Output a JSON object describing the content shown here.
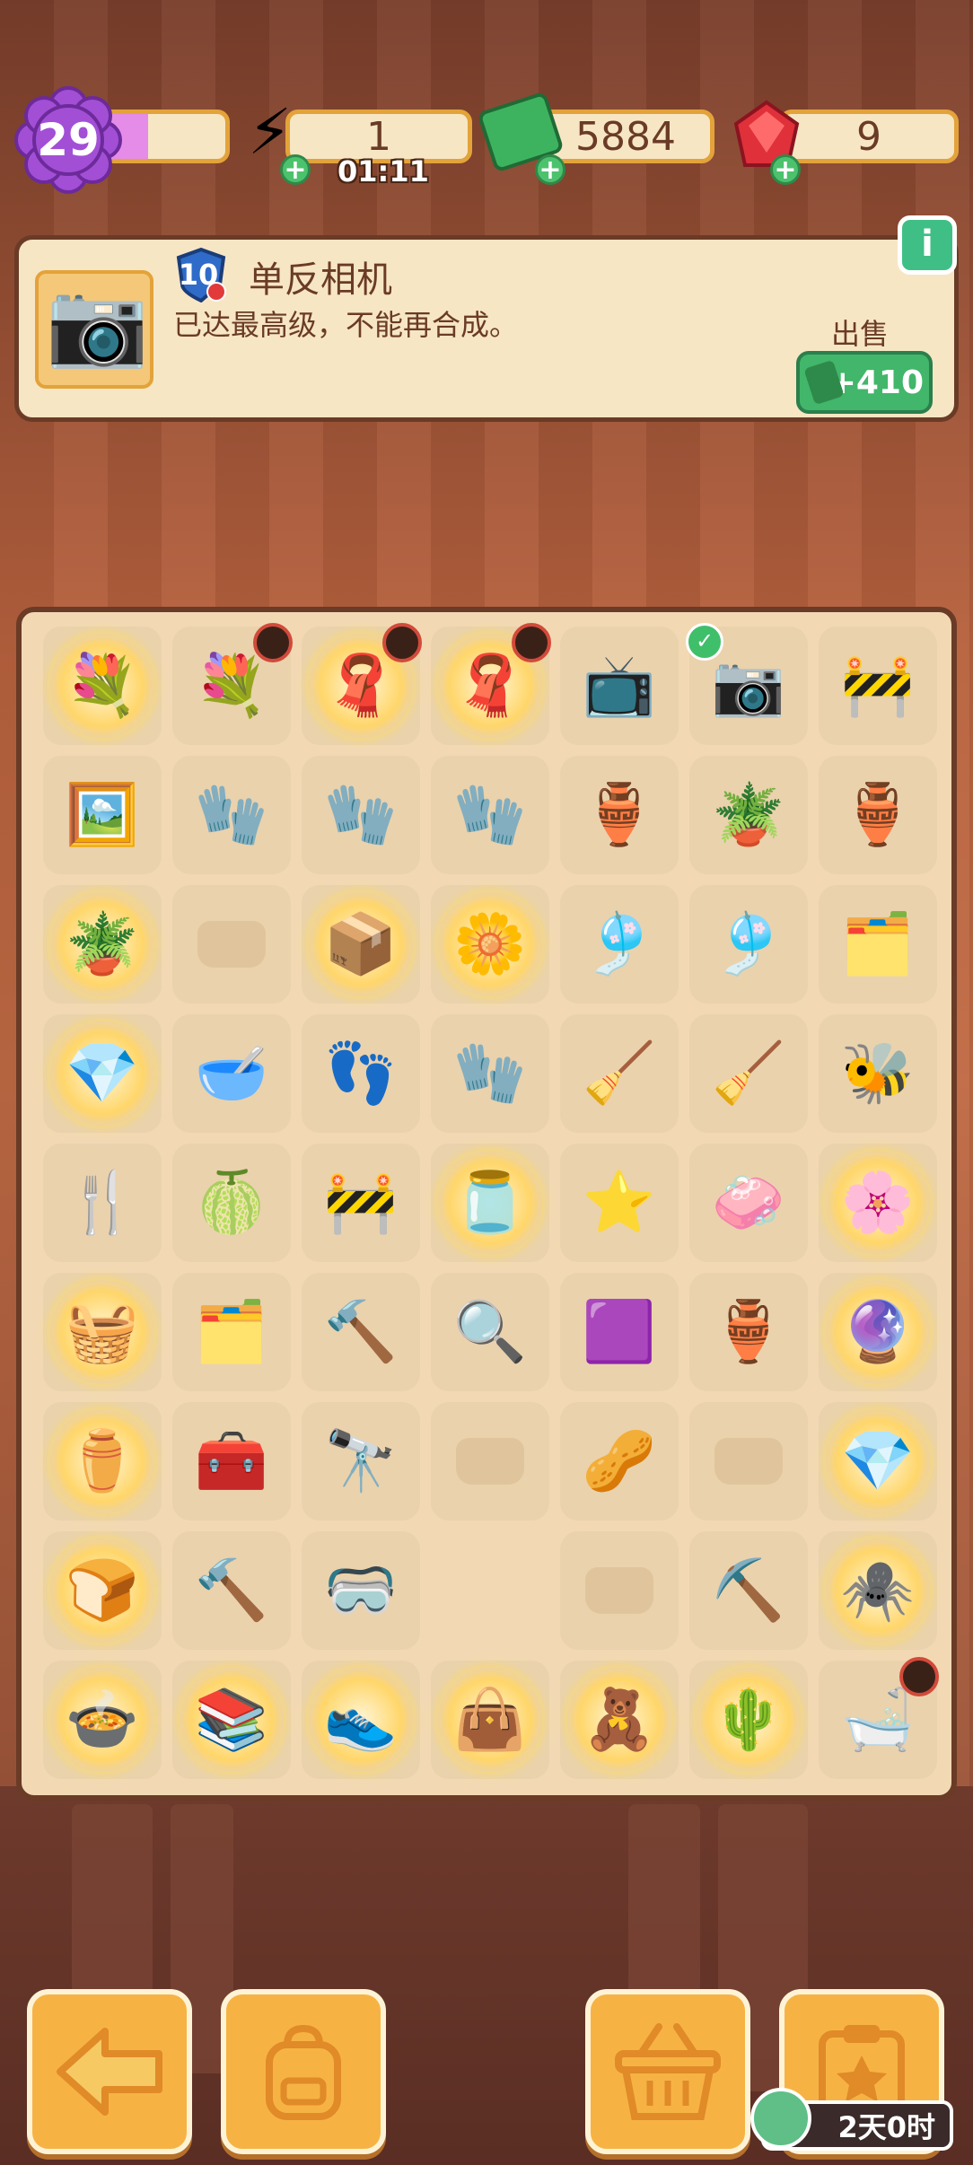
{
  "top_bar": {
    "level": "29",
    "xp_fraction": 0.38,
    "energy": "1",
    "energy_timer": "01:11",
    "cash": "5884",
    "gems": "9"
  },
  "info_panel": {
    "item_level": "10",
    "item_name": "单反相机",
    "item_desc": "已达最高级，不能再合成。",
    "sell_label": "出售",
    "sell_price": "+410",
    "info_button": "i"
  },
  "board": {
    "cells": [
      {
        "icon": "flower-bowl-bubble-icon",
        "glyph": "💐",
        "glow": true
      },
      {
        "icon": "flower-bouquet-icon",
        "glyph": "💐",
        "glow": false,
        "timer": true
      },
      {
        "icon": "cloth-bubble-icon",
        "glyph": "🧣",
        "glow": true,
        "timer": true
      },
      {
        "icon": "cloth-bubble-icon",
        "glyph": "🧣",
        "glow": true,
        "timer": true
      },
      {
        "icon": "cat-tv-icon",
        "glyph": "📺",
        "glow": false
      },
      {
        "icon": "camera-icon",
        "glyph": "📷",
        "glow": false,
        "check": true
      },
      {
        "icon": "warning-barrier-icon",
        "glyph": "🚧",
        "glow": false
      },
      {
        "icon": "poster-icon",
        "glyph": "🖼️",
        "glow": false
      },
      {
        "icon": "red-glove-icon",
        "glyph": "🧤",
        "glow": false
      },
      {
        "icon": "red-glove-icon",
        "glyph": "🧤",
        "glow": false
      },
      {
        "icon": "red-glove-icon",
        "glyph": "🧤",
        "glow": false
      },
      {
        "icon": "broken-pot-icon",
        "glyph": "🏺",
        "glow": false
      },
      {
        "icon": "clay-pot-icon",
        "glyph": "🪴",
        "glow": false
      },
      {
        "icon": "pot-shard-icon",
        "glyph": "🏺",
        "glow": false
      },
      {
        "icon": "plant-box-bubble-icon",
        "glyph": "🪴",
        "glow": true
      },
      {
        "icon": "empty-slot",
        "glyph": "",
        "glow": false,
        "ghost": true
      },
      {
        "icon": "sign-box-bubble-icon",
        "glyph": "📦",
        "glow": true
      },
      {
        "icon": "flower-box-bubble-icon",
        "glyph": "🌼",
        "glow": true
      },
      {
        "icon": "jellyfish-icon",
        "glyph": "🎐",
        "glow": false
      },
      {
        "icon": "jellyfish-large-icon",
        "glyph": "🎐",
        "glow": false
      },
      {
        "icon": "envelope-folder-icon",
        "glyph": "🗂️",
        "glow": false
      },
      {
        "icon": "gem-frame-bubble-icon",
        "glyph": "💎",
        "glow": true
      },
      {
        "icon": "green-bowl-icon",
        "glyph": "🥣",
        "glow": false
      },
      {
        "icon": "footprint-bag-icon",
        "glyph": "👣",
        "glow": false
      },
      {
        "icon": "red-glove-icon",
        "glyph": "🧤",
        "glow": false
      },
      {
        "icon": "rake-icon",
        "glyph": "🧹",
        "glow": false
      },
      {
        "icon": "green-broom-icon",
        "glyph": "🧹",
        "glow": false
      },
      {
        "icon": "bee-icon",
        "glyph": "🐝",
        "glow": false
      },
      {
        "icon": "hand-fork-icon",
        "glyph": "🍴",
        "glow": false
      },
      {
        "icon": "green-leaf-icon",
        "glyph": "🍈",
        "glow": false
      },
      {
        "icon": "barrier-cone-icon",
        "glyph": "🚧",
        "glow": false
      },
      {
        "icon": "jar-bubble-icon",
        "glyph": "🫙",
        "glow": true
      },
      {
        "icon": "purple-star-icon",
        "glyph": "⭐",
        "glow": false
      },
      {
        "icon": "green-soap-icon",
        "glyph": "🧼",
        "glow": false
      },
      {
        "icon": "flower-globe-bubble-icon",
        "glyph": "🌸",
        "glow": true
      },
      {
        "icon": "basket-bubble-icon",
        "glyph": "🧺",
        "glow": true
      },
      {
        "icon": "envelope-folder-icon",
        "glyph": "🗂️",
        "glow": false
      },
      {
        "icon": "trowel-icon",
        "glyph": "🔨",
        "glow": false
      },
      {
        "icon": "magnifier-icon",
        "glyph": "🔍",
        "glow": false
      },
      {
        "icon": "purple-gem-icon",
        "glyph": "🟪",
        "glow": false
      },
      {
        "icon": "small-pot-icon",
        "glyph": "🏺",
        "glow": false
      },
      {
        "icon": "crystal-bubble-icon",
        "glyph": "🔮",
        "glow": true
      },
      {
        "icon": "vase-bubble-icon",
        "glyph": "⚱️",
        "glow": true
      },
      {
        "icon": "red-toolbox-icon",
        "glyph": "🧰",
        "glow": false
      },
      {
        "icon": "telescope-icon",
        "glyph": "🔭",
        "glow": false
      },
      {
        "icon": "empty-slot",
        "glyph": "",
        "glow": false,
        "ghost": true
      },
      {
        "icon": "seed-bag-icon",
        "glyph": "🥜",
        "glow": false
      },
      {
        "icon": "empty-slot",
        "glyph": "",
        "glow": false,
        "ghost": true
      },
      {
        "icon": "diamond-bubble-icon",
        "glyph": "💎",
        "glow": true
      },
      {
        "icon": "bread-bubble-icon",
        "glyph": "🍞",
        "glow": true
      },
      {
        "icon": "hammer-icon",
        "glyph": "🔨",
        "glow": false
      },
      {
        "icon": "goggles-icon",
        "glyph": "🥽",
        "glow": false
      },
      {
        "icon": "empty-slot",
        "glyph": "",
        "glow": false,
        "empty": true
      },
      {
        "icon": "empty-slot",
        "glyph": "",
        "glow": false,
        "ghost": true
      },
      {
        "icon": "shovel-icon",
        "glyph": "⛏️",
        "glow": false
      },
      {
        "icon": "spider-bubble-icon",
        "glyph": "🕷️",
        "glow": true
      },
      {
        "icon": "bowl-bubble-icon",
        "glyph": "🍲",
        "glow": true
      },
      {
        "icon": "books-bubble-icon",
        "glyph": "📚",
        "glow": true
      },
      {
        "icon": "shoe-bubble-icon",
        "glyph": "👟",
        "glow": true
      },
      {
        "icon": "bag-bubble-icon",
        "glyph": "👜",
        "glow": true
      },
      {
        "icon": "toy-bubble-icon",
        "glyph": "🧸",
        "glow": true
      },
      {
        "icon": "cactus-bubble-icon",
        "glyph": "🌵",
        "glow": true
      },
      {
        "icon": "bathtub-icon",
        "glyph": "🛁",
        "glow": false,
        "timer": true
      }
    ]
  },
  "bottom_bar": {
    "back_icon": "arrow-left-icon",
    "bag_icon": "backpack-icon",
    "basket_icon": "basket-icon",
    "task_icon": "clipboard-star-icon",
    "event_timer": "2天0时"
  },
  "colors": {
    "accent": "#e3a33a",
    "panel": "#f7e6c4",
    "outline": "#6a3b26",
    "sell_green": "#42b66a",
    "xp_pink": "#e48ce8"
  }
}
